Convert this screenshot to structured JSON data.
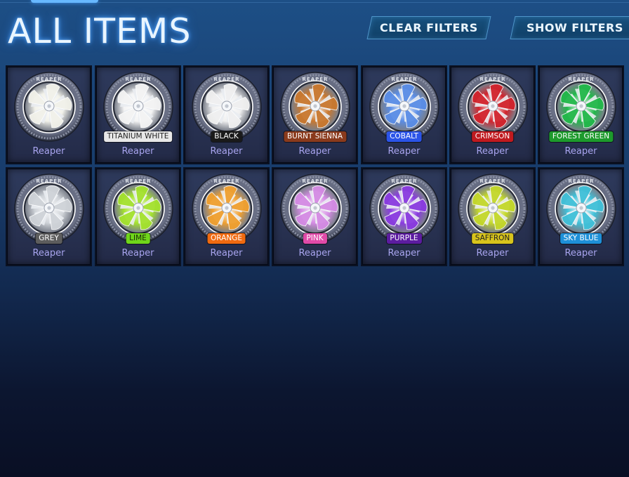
{
  "page": {
    "title": "ALL ITEMS",
    "buttons": {
      "clear_filters": "CLEAR FILTERS",
      "show_filters": "SHOW FILTERS"
    }
  },
  "items": [
    {
      "name": "Reaper",
      "color_label": "",
      "paint": "#f2f2ea",
      "badge_color": "",
      "badge_text_color": "#ffffff"
    },
    {
      "name": "Reaper",
      "color_label": "TITANIUM WHITE",
      "paint": "#f4f4f4",
      "badge_color": "#e8e8e8",
      "badge_text_color": "#222222"
    },
    {
      "name": "Reaper",
      "color_label": "BLACK",
      "paint": "#f0f0f0",
      "badge_color": "#1a1a1a",
      "badge_text_color": "#ffffff"
    },
    {
      "name": "Reaper",
      "color_label": "BURNT SIENNA",
      "paint": "#c9782f",
      "badge_color": "#8a3a1c",
      "badge_text_color": "#ffffff"
    },
    {
      "name": "Reaper",
      "color_label": "COBALT",
      "paint": "#5a8de6",
      "badge_color": "#2b54e8",
      "badge_text_color": "#ffffff"
    },
    {
      "name": "Reaper",
      "color_label": "CRIMSON",
      "paint": "#d2232c",
      "badge_color": "#c01a1f",
      "badge_text_color": "#ffffff"
    },
    {
      "name": "Reaper",
      "color_label": "FOREST GREEN",
      "paint": "#22b84a",
      "badge_color": "#1d9a2c",
      "badge_text_color": "#ffffff"
    },
    {
      "name": "Reaper",
      "color_label": "GREY",
      "paint": "#cfd3d8",
      "badge_color": "#5d5d5d",
      "badge_text_color": "#ffffff"
    },
    {
      "name": "Reaper",
      "color_label": "LIME",
      "paint": "#a4e22e",
      "badge_color": "#6fd61a",
      "badge_text_color": "#1a2a06"
    },
    {
      "name": "Reaper",
      "color_label": "ORANGE",
      "paint": "#f0a030",
      "badge_color": "#f06a10",
      "badge_text_color": "#ffffff"
    },
    {
      "name": "Reaper",
      "color_label": "PINK",
      "paint": "#d58be4",
      "badge_color": "#e04aa8",
      "badge_text_color": "#ffffff"
    },
    {
      "name": "Reaper",
      "color_label": "PURPLE",
      "paint": "#8a3be0",
      "badge_color": "#5c1ca0",
      "badge_text_color": "#ffffff"
    },
    {
      "name": "Reaper",
      "color_label": "SAFFRON",
      "paint": "#c4d82a",
      "badge_color": "#d8c41c",
      "badge_text_color": "#222222"
    },
    {
      "name": "Reaper",
      "color_label": "SKY BLUE",
      "paint": "#40c0d8",
      "badge_color": "#1e90d8",
      "badge_text_color": "#ffffff"
    }
  ]
}
